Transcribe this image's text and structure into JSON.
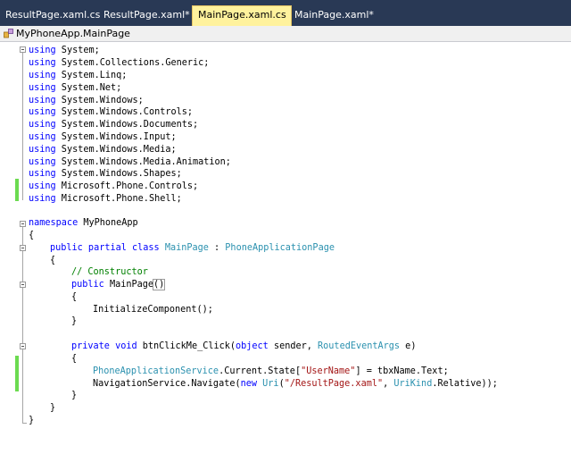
{
  "tabs": [
    {
      "label": "ResultPage.xaml.cs"
    },
    {
      "label": "ResultPage.xaml*"
    },
    {
      "label": "MainPage.xaml.cs"
    },
    {
      "label": "MainPage.xaml*"
    }
  ],
  "close_glyph": "✕",
  "nav": {
    "class_name": "MyPhoneApp.MainPage"
  },
  "code": {
    "usings": [
      [
        "using",
        " System;"
      ],
      [
        "using",
        " System.Collections.Generic;"
      ],
      [
        "using",
        " System.Linq;"
      ],
      [
        "using",
        " System.Net;"
      ],
      [
        "using",
        " System.Windows;"
      ],
      [
        "using",
        " System.Windows.Controls;"
      ],
      [
        "using",
        " System.Windows.Documents;"
      ],
      [
        "using",
        " System.Windows.Input;"
      ],
      [
        "using",
        " System.Windows.Media;"
      ],
      [
        "using",
        " System.Windows.Media.Animation;"
      ],
      [
        "using",
        " System.Windows.Shapes;"
      ],
      [
        "using",
        " Microsoft.Phone.Controls;"
      ],
      [
        "using",
        " Microsoft.Phone.Shell;"
      ]
    ],
    "ns_kw": "namespace",
    "ns_name": " MyPhoneApp",
    "open_brace": "{",
    "close_brace": "}",
    "class_kw": "public partial class",
    "class_name": "MainPage",
    "colon": " : ",
    "base_class": "PhoneApplicationPage",
    "comment": "// Constructor",
    "ctor_kw": "public",
    "ctor_name": " MainPage",
    "ctor_parens": "()",
    "init_call": "InitializeComponent();",
    "method_kw": "private void",
    "method_name": " btnClickMe_Click(",
    "object_kw": "object",
    "sender": " sender, ",
    "args_type": "RoutedEventArgs",
    "args_name": " e)",
    "state_type": "PhoneApplicationService",
    "state_mid": ".Current.State[",
    "state_key": "\"UserName\"",
    "state_end": "] = tbxName.Text;",
    "nav_call": "NavigationService.Navigate(",
    "new_kw": "new",
    "uri_type": " Uri",
    "uri_open": "(",
    "uri_str": "\"/ResultPage.xaml\"",
    "uri_mid": ", ",
    "urikind_type": "UriKind",
    "uri_end": ".Relative));"
  }
}
